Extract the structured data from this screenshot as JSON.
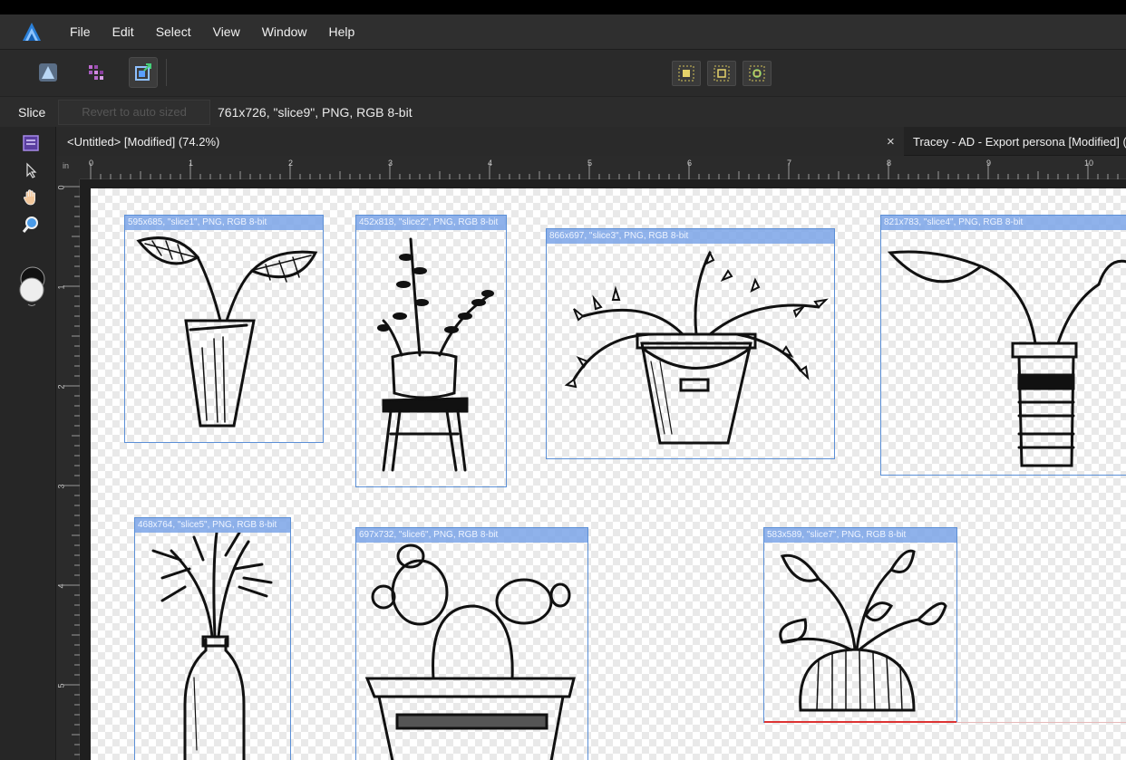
{
  "menubar": {
    "items": [
      "File",
      "Edit",
      "Select",
      "View",
      "Window",
      "Help"
    ]
  },
  "toolbar": {
    "personas": [
      "designer-persona-icon",
      "pixel-persona-icon",
      "export-persona-icon"
    ],
    "snapping": [
      "select-all-slices-icon",
      "deselect-slices-icon",
      "create-slice-icon"
    ]
  },
  "contextbar": {
    "tool_label": "Slice",
    "revert_button": "Revert to auto sized",
    "selection_info": "761x726, \"slice9\", PNG, RGB 8-bit"
  },
  "tabs": {
    "active": "<Untitled> [Modified] (74.2%)",
    "inactive": "Tracey - AD - Export persona [Modified] (",
    "close_symbol": "×"
  },
  "ruler": {
    "unit": "in",
    "h_ticks": [
      "0",
      "1",
      "2",
      "3",
      "4",
      "5",
      "6",
      "7",
      "8",
      "9",
      "10"
    ],
    "v_ticks": [
      "0",
      "1",
      "2",
      "3",
      "4",
      "5"
    ]
  },
  "slices": [
    {
      "label": "595x685, \"slice1\", PNG, RGB 8-bit",
      "drawing": "potted-leaf-plant"
    },
    {
      "label": "452x818, \"slice2\", PNG, RGB 8-bit",
      "drawing": "plant-on-stool"
    },
    {
      "label": "866x697, \"slice3\", PNG, RGB 8-bit",
      "drawing": "trailing-plant-bucket"
    },
    {
      "label": "821x783, \"slice4\", PNG, RGB 8-bit",
      "drawing": "striped-vase-plant"
    },
    {
      "label": "468x764, \"slice5\", PNG, RGB 8-bit",
      "drawing": "branches-in-bottle"
    },
    {
      "label": "697x732, \"slice6\", PNG, RGB 8-bit",
      "drawing": "cactus-pot"
    },
    {
      "label": "583x589, \"slice7\", PNG, RGB 8-bit",
      "drawing": "bowl-leaf-plant"
    }
  ],
  "colors": {
    "slice_border": "#5b8fd6",
    "slice_label_bg": "#7ba5e8",
    "accent_purple": "#8a63d2",
    "menubar_bg": "#2f2f2f"
  }
}
